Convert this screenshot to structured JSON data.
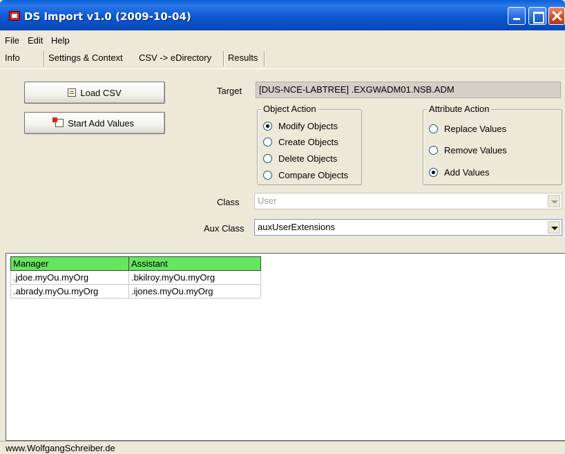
{
  "window": {
    "title": "DS Import v1.0 (2009-10-04)"
  },
  "menu": [
    "File",
    "Edit",
    "Help"
  ],
  "tabs": [
    "Info",
    "Settings & Context",
    "CSV -> eDirectory",
    "Results"
  ],
  "buttons": {
    "load_csv": "Load CSV",
    "start_add_values": "Start Add Values"
  },
  "target": {
    "label": "Target",
    "value": "[DUS-NCE-LABTREE] .EXGWADM01.NSB.ADM"
  },
  "object_action": {
    "title": "Object Action",
    "options": [
      "Modify Objects",
      "Create Objects",
      "Delete Objects",
      "Compare Objects"
    ],
    "selected": "Modify Objects"
  },
  "attribute_action": {
    "title": "Attribute Action",
    "options": [
      "Replace Values",
      "Remove Values",
      "Add Values"
    ],
    "selected": "Add Values"
  },
  "class": {
    "label": "Class",
    "value": "User"
  },
  "aux_class": {
    "label": "Aux Class",
    "value": "auxUserExtensions"
  },
  "grid": {
    "columns": [
      "Manager",
      "Assistant"
    ],
    "rows": [
      [
        ".jdoe.myOu.myOrg",
        ".bkilroy.myOu.myOrg"
      ],
      [
        ".abrady.myOu.myOrg",
        ".ijones.myOu.myOrg"
      ]
    ],
    "header_color": "#66e55f"
  },
  "status": {
    "text": "www.WolfgangSchreiber.de"
  }
}
